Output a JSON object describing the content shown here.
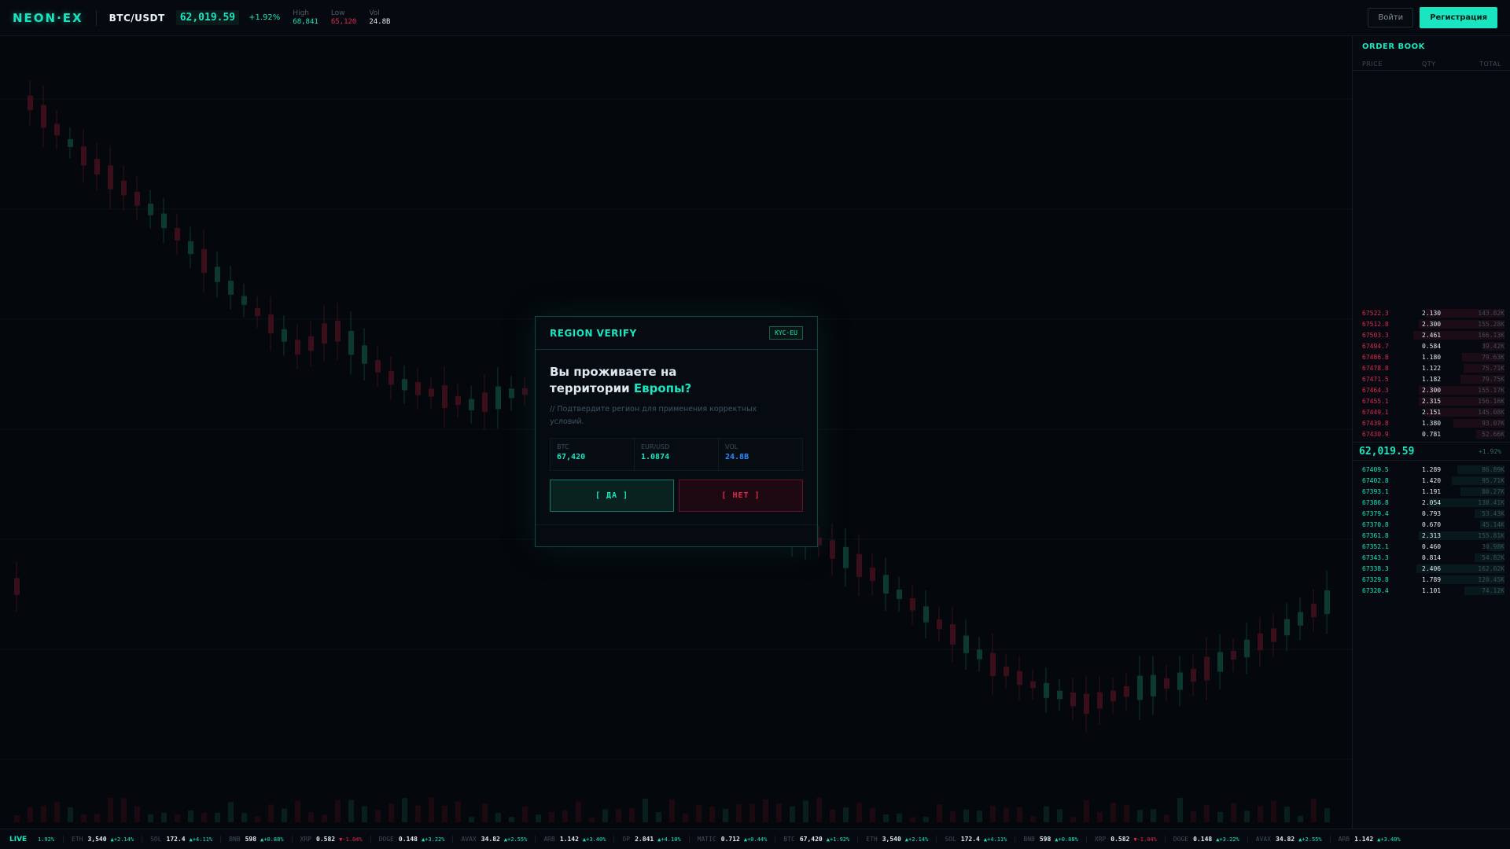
{
  "header": {
    "logo": "NEON·EX",
    "pair": "BTC/USDT",
    "price": "62,019.59",
    "change": "+1.92%",
    "stats": [
      {
        "label": "High",
        "value": "68,841",
        "color": "#19e6c1"
      },
      {
        "label": "Low",
        "value": "65,120",
        "color": "#e0284f"
      },
      {
        "label": "Vol",
        "value": "24.8B",
        "color": "#dfeef2"
      }
    ],
    "login_label": "Войти",
    "register_label": "Регистрация"
  },
  "orderbook": {
    "title": "ORDER BOOK",
    "columns": [
      "PRICE",
      "QTY",
      "TOTAL"
    ],
    "asks": [
      {
        "price": "67522.3",
        "qty": "2.130",
        "total": "143.82K",
        "depth": 0.55
      },
      {
        "price": "67512.8",
        "qty": "2.300",
        "total": "155.28K",
        "depth": 0.6
      },
      {
        "price": "67503.3",
        "qty": "2.461",
        "total": "166.13K",
        "depth": 0.64
      },
      {
        "price": "67494.7",
        "qty": "0.584",
        "total": "39.42K",
        "depth": 0.15
      },
      {
        "price": "67486.8",
        "qty": "1.180",
        "total": "79.63K",
        "depth": 0.3
      },
      {
        "price": "67478.8",
        "qty": "1.122",
        "total": "75.71K",
        "depth": 0.29
      },
      {
        "price": "67471.5",
        "qty": "1.182",
        "total": "79.75K",
        "depth": 0.31
      },
      {
        "price": "67464.3",
        "qty": "2.300",
        "total": "155.17K",
        "depth": 0.6
      },
      {
        "price": "67455.1",
        "qty": "2.315",
        "total": "156.16K",
        "depth": 0.6
      },
      {
        "price": "67449.1",
        "qty": "2.151",
        "total": "145.08K",
        "depth": 0.56
      },
      {
        "price": "67439.8",
        "qty": "1.380",
        "total": "93.07K",
        "depth": 0.36
      },
      {
        "price": "67430.9",
        "qty": "0.781",
        "total": "52.66K",
        "depth": 0.2
      }
    ],
    "mid_price": "62,019.59",
    "mid_change": "+1.92%",
    "bids": [
      {
        "price": "67409.5",
        "qty": "1.289",
        "total": "86.89K",
        "depth": 0.33
      },
      {
        "price": "67402.8",
        "qty": "1.420",
        "total": "95.71K",
        "depth": 0.37
      },
      {
        "price": "67393.1",
        "qty": "1.191",
        "total": "80.27K",
        "depth": 0.31
      },
      {
        "price": "67386.8",
        "qty": "2.054",
        "total": "138.41K",
        "depth": 0.53
      },
      {
        "price": "67379.4",
        "qty": "0.793",
        "total": "53.43K",
        "depth": 0.21
      },
      {
        "price": "67370.8",
        "qty": "0.670",
        "total": "45.14K",
        "depth": 0.17
      },
      {
        "price": "67361.8",
        "qty": "2.313",
        "total": "155.81K",
        "depth": 0.6
      },
      {
        "price": "67352.1",
        "qty": "0.460",
        "total": "30.98K",
        "depth": 0.12
      },
      {
        "price": "67343.3",
        "qty": "0.814",
        "total": "54.82K",
        "depth": 0.21
      },
      {
        "price": "67338.3",
        "qty": "2.406",
        "total": "162.02K",
        "depth": 0.62
      },
      {
        "price": "67329.8",
        "qty": "1.789",
        "total": "120.45K",
        "depth": 0.46
      },
      {
        "price": "67320.4",
        "qty": "1.101",
        "total": "74.12K",
        "depth": 0.28
      }
    ]
  },
  "ticker": {
    "live_label": "LIVE",
    "live_change": "1.92%",
    "items": [
      {
        "sym": "ETH",
        "value": "3,540",
        "change": "▲+2.14%",
        "dir": "up"
      },
      {
        "sym": "SOL",
        "value": "172.4",
        "change": "▲+4.11%",
        "dir": "up"
      },
      {
        "sym": "BNB",
        "value": "598",
        "change": "▲+0.88%",
        "dir": "up"
      },
      {
        "sym": "XRP",
        "value": "0.582",
        "change": "▼-1.04%",
        "dir": "down"
      },
      {
        "sym": "DOGE",
        "value": "0.148",
        "change": "▲+3.22%",
        "dir": "up"
      },
      {
        "sym": "AVAX",
        "value": "34.82",
        "change": "▲+2.55%",
        "dir": "up"
      },
      {
        "sym": "ARB",
        "value": "1.142",
        "change": "▲+3.40%",
        "dir": "up"
      },
      {
        "sym": "OP",
        "value": "2.841",
        "change": "▲+4.10%",
        "dir": "up"
      },
      {
        "sym": "MATIC",
        "value": "0.712",
        "change": "▲+0.44%",
        "dir": "up"
      },
      {
        "sym": "BTC",
        "value": "67,420",
        "change": "▲+1.92%",
        "dir": "up"
      },
      {
        "sym": "ETH",
        "value": "3,540",
        "change": "▲+2.14%",
        "dir": "up"
      },
      {
        "sym": "SOL",
        "value": "172.4",
        "change": "▲+4.11%",
        "dir": "up"
      },
      {
        "sym": "BNB",
        "value": "598",
        "change": "▲+0.88%",
        "dir": "up"
      },
      {
        "sym": "XRP",
        "value": "0.582",
        "change": "▼-1.04%",
        "dir": "down"
      },
      {
        "sym": "DOGE",
        "value": "0.148",
        "change": "▲+3.22%",
        "dir": "up"
      },
      {
        "sym": "AVAX",
        "value": "34.82",
        "change": "▲+2.55%",
        "dir": "up"
      },
      {
        "sym": "ARB",
        "value": "1.142",
        "change": "▲+3.40%",
        "dir": "up"
      }
    ]
  },
  "modal": {
    "title": "REGION VERIFY",
    "badge": "KYC·EU",
    "question_line1": "Вы проживаете на",
    "question_line2": "территории",
    "question_highlight": "Европы?",
    "subtitle": "// Подтвердите регион для применения корректных условий.",
    "stats": [
      {
        "label": "BTC",
        "value": "67,420",
        "color": "#19e6c1"
      },
      {
        "label": "EUR/USD",
        "value": "1.0874",
        "color": "#19e6c1"
      },
      {
        "label": "VOL",
        "value": "24.8B",
        "color": "#2a8cff"
      }
    ],
    "yes_label": "[ ДА ]",
    "no_label": "[ НЕТ ]"
  },
  "colors": {
    "accent": "#19e6c1",
    "down": "#e0284f",
    "background": "#04070c"
  }
}
